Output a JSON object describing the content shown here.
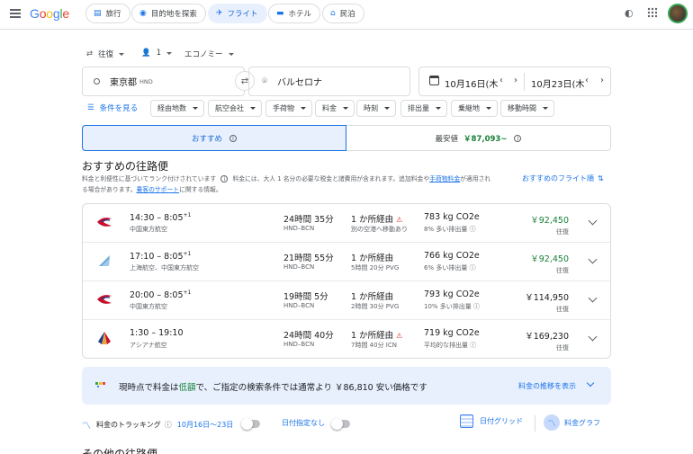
{
  "header": {
    "logo": "Google",
    "chips": [
      "旅行",
      "目的地を探索",
      "フライト",
      "ホテル",
      "民泊"
    ]
  },
  "search": {
    "trip_type": "往復",
    "passengers": "1",
    "cabin": "エコノミー",
    "origin": "東京都",
    "origin_code": "HND",
    "destination": "バルセロナ",
    "depart_date": "10月16日(木",
    "return_date": "10月23日(木"
  },
  "filters": {
    "all_filters": "条件を見る",
    "items": [
      "経由地数",
      "航空会社",
      "手荷物",
      "料金",
      "時刻",
      "排出量",
      "乗継地",
      "移動時間"
    ]
  },
  "tabs": {
    "recommended": "おすすめ",
    "cheapest": "最安値",
    "cheapest_price": "￥87,093~"
  },
  "section": {
    "title": "おすすめの往路便",
    "note1": "料金と利便性に基づいてランク付けされています",
    "note2a": "料金には、大人 1 名分の必要な税金と諸費用が含まれます。追加料金や",
    "note2b": "手荷物料金",
    "note2c": "が適用され",
    "note3a": "る場合があります。",
    "note3b": "乗客のサポート",
    "note3c": "に関する情報。",
    "sort_label": "おすすめのフライト順"
  },
  "flights": [
    {
      "time": "14:30 – 8:05",
      "plus": "+1",
      "airline": "中国東方航空",
      "duration": "24時間 35分",
      "route": "HND–BCN",
      "stops": "1 か所経由",
      "stop_detail": "別の空港へ移動あり",
      "warn": true,
      "co2": "783 kg CO2e",
      "co2_note": "8% 多い排出量",
      "price": "￥92,450",
      "price_green": true,
      "price_note": "往復"
    },
    {
      "time": "17:10 – 8:05",
      "plus": "+1",
      "airline": "上海航空、中国東方航空",
      "duration": "21時間 55分",
      "route": "HND–BCN",
      "stops": "1 か所経由",
      "stop_detail": "5時間 20分 PVG",
      "warn": false,
      "co2": "766 kg CO2e",
      "co2_note": "6% 多い排出量",
      "price": "￥92,450",
      "price_green": true,
      "price_note": "往復"
    },
    {
      "time": "20:00 – 8:05",
      "plus": "+1",
      "airline": "中国東方航空",
      "duration": "19時間 5分",
      "route": "HND–BCN",
      "stops": "1 か所経由",
      "stop_detail": "2時間 30分 PVG",
      "warn": false,
      "co2": "793 kg CO2e",
      "co2_note": "10% 多い排出量",
      "price": "￥114,950",
      "price_green": false,
      "price_note": "往復"
    },
    {
      "time": "1:30 – 19:10",
      "plus": "",
      "airline": "アシアナ航空",
      "duration": "24時間 40分",
      "route": "HND–BCN",
      "stops": "1 か所経由",
      "stop_detail": "7時間 40分 ICN",
      "warn": true,
      "co2": "719 kg CO2e",
      "co2_note": "平均的な排出量",
      "price": "￥169,230",
      "price_green": false,
      "price_note": "往復"
    }
  ],
  "insight": {
    "text_a": "現時点で料金は",
    "text_low": "低額",
    "text_b": "で、ご指定の検索条件では通常より ￥86,810 安い価格です",
    "link": "料金の推移を表示"
  },
  "tracking": {
    "label": "料金のトラッキング",
    "dates": "10月16日～23日",
    "any_dates": "日付指定なし",
    "date_grid": "日付グリッド",
    "price_graph": "料金グラフ"
  },
  "next_section": "その他の往路便",
  "colors": {
    "accent": "#1a73e8",
    "green": "#188038",
    "warn": "#d93025"
  }
}
